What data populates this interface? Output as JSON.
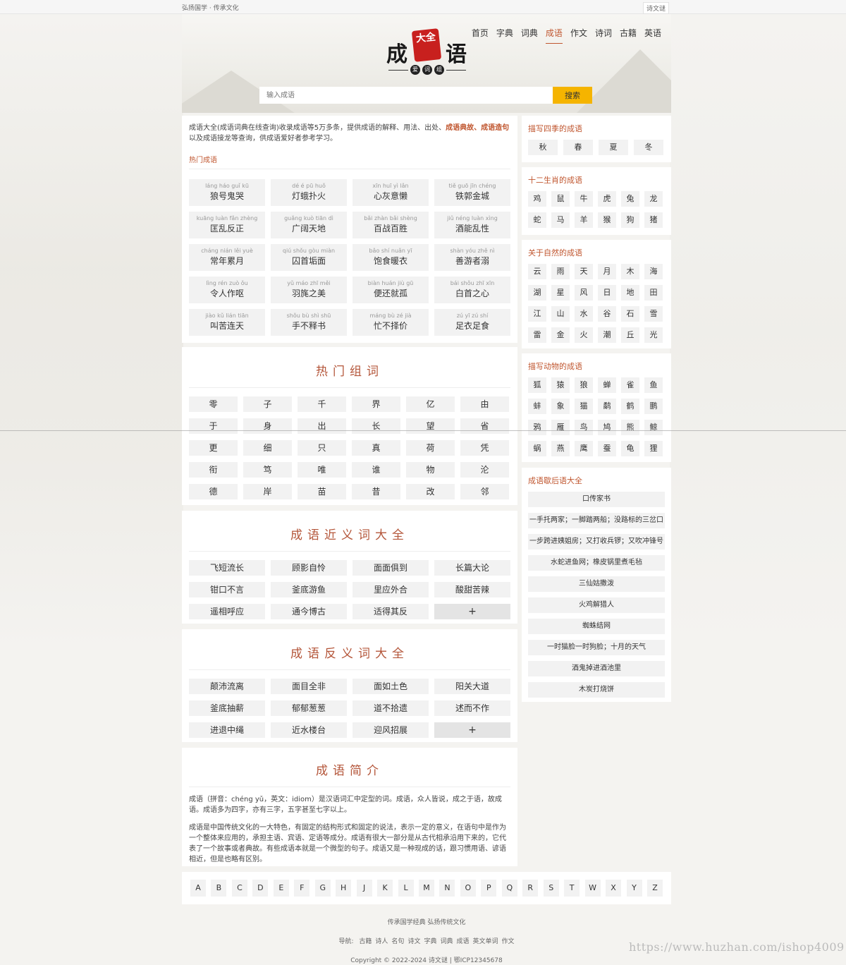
{
  "topbar": {
    "left": "弘扬国学 · 传承文化",
    "right": "诗文谜"
  },
  "nav": [
    "首页",
    "字典",
    "词典",
    "成语",
    "作文",
    "诗词",
    "古籍",
    "英语"
  ],
  "nav_active": 3,
  "logo": {
    "char1": "成",
    "seal": "大全",
    "char2": "语",
    "sub": [
      "爱",
      "词",
      "组"
    ]
  },
  "search": {
    "placeholder": "输入成语",
    "button": "搜索"
  },
  "intro": {
    "text1": "成语大全(成语词典在线查询)收录成语等5万多条，提供成语的解释、用法、出处、",
    "hl1": "成语典故",
    "sep": "、",
    "hl2": "成语造句",
    "text2": "以及成语接龙等查询，供成语爱好者参考学习。",
    "hot_title": "热门成语"
  },
  "hot_idioms": [
    {
      "py": "láng háo guǐ kū",
      "w": "狼号鬼哭"
    },
    {
      "py": "dé é pū huǒ",
      "w": "灯蛾扑火"
    },
    {
      "py": "xīn huī yì lǎn",
      "w": "心灰意懒"
    },
    {
      "py": "tiě guō jīn chéng",
      "w": "铁郭金城"
    },
    {
      "py": "kuāng luàn fǎn zhèng",
      "w": "匡乱反正"
    },
    {
      "py": "guǎng kuò tiān dì",
      "w": "广阔天地"
    },
    {
      "py": "bǎi zhàn bǎi shèng",
      "w": "百战百胜"
    },
    {
      "py": "jiǔ néng luàn xìng",
      "w": "酒能乱性"
    },
    {
      "py": "cháng nián lěi yuè",
      "w": "常年累月"
    },
    {
      "py": "qiú shǒu gòu miàn",
      "w": "囚首垢面"
    },
    {
      "py": "bǎo shí nuǎn yī",
      "w": "饱食暖衣"
    },
    {
      "py": "shàn yóu zhě nì",
      "w": "善游者溺"
    },
    {
      "py": "lìng rén zuò ǒu",
      "w": "令人作呕"
    },
    {
      "py": "yǔ máo zhī měi",
      "w": "羽旄之美"
    },
    {
      "py": "biàn huán jiù gū",
      "w": "便还就孤"
    },
    {
      "py": "bái shǒu zhī xīn",
      "w": "白首之心"
    },
    {
      "py": "jiào kǔ lián tiān",
      "w": "叫苦连天"
    },
    {
      "py": "shǒu bù shì shū",
      "w": "手不释书"
    },
    {
      "py": "máng bù zé jià",
      "w": "忙不择价"
    },
    {
      "py": "zú yī zú shí",
      "w": "足衣足食"
    }
  ],
  "hot_words": {
    "title": "热门组词",
    "items": [
      "零",
      "子",
      "千",
      "界",
      "亿",
      "由",
      "于",
      "身",
      "出",
      "长",
      "望",
      "省",
      "更",
      "细",
      "只",
      "真",
      "荷",
      "凭",
      "衔",
      "笃",
      "唯",
      "谁",
      "物",
      "沦",
      "德",
      "岸",
      "苗",
      "昔",
      "改",
      "邻"
    ]
  },
  "synonyms": {
    "title": "成语近义词大全",
    "items": [
      "飞短流长",
      "顾影自怜",
      "面面俱到",
      "长篇大论",
      "钳口不言",
      "釜底游鱼",
      "里应外合",
      "酸甜苦辣",
      "遥相呼应",
      "通今博古",
      "适得其反"
    ],
    "more": "+"
  },
  "antonyms": {
    "title": "成语反义词大全",
    "items": [
      "颠沛流离",
      "面目全非",
      "面如土色",
      "阳关大道",
      "釜底抽薪",
      "郁郁葱葱",
      "道不拾遗",
      "述而不作",
      "进退中绳",
      "近水楼台",
      "迎风招展"
    ],
    "more": "+"
  },
  "description": {
    "title": "成语简介",
    "p1": "成语（拼音：chéng yǔ，英文：idiom）是汉语词汇中定型的词。成语，众人皆说，成之于语，故成语。成语多为四字，亦有三字，五字甚至七字以上。",
    "p2": "成语是中国传统文化的一大特色，有固定的结构形式和固定的说法，表示一定的意义，在语句中是作为一个整体来应用的，承担主语、宾语、定语等成分。成语有很大一部分是从古代相承沿用下来的，它代表了一个故事或者典故。有些成语本就是一个微型的句子。成语又是一种现成的话，跟习惯用语、谚语相近，但是也略有区别。"
  },
  "side": {
    "seasons": {
      "title": "描写四季的成语",
      "items": [
        "秋",
        "春",
        "夏",
        "冬"
      ]
    },
    "zodiac": {
      "title": "十二生肖的成语",
      "items": [
        "鸡",
        "鼠",
        "牛",
        "虎",
        "兔",
        "龙",
        "蛇",
        "马",
        "羊",
        "猴",
        "狗",
        "猪"
      ]
    },
    "nature": {
      "title": "关于自然的成语",
      "items": [
        "云",
        "雨",
        "天",
        "月",
        "木",
        "海",
        "湖",
        "星",
        "风",
        "日",
        "地",
        "田",
        "江",
        "山",
        "水",
        "谷",
        "石",
        "雪",
        "雷",
        "金",
        "火",
        "潮",
        "丘",
        "光"
      ]
    },
    "animals": {
      "title": "描写动物的成语",
      "items": [
        "狐",
        "猿",
        "狼",
        "蝉",
        "雀",
        "鱼",
        "蚌",
        "象",
        "猫",
        "鹬",
        "鹤",
        "鹏",
        "鸦",
        "雁",
        "鸟",
        "鸠",
        "熊",
        "鲸",
        "蜗",
        "燕",
        "鹰",
        "蚕",
        "龟",
        "狸"
      ]
    },
    "xiehouyu": {
      "title": "成语歇后语大全",
      "items": [
        "口传家书",
        "一手托两家；一脚踏两船；没路标的三岔口",
        "一步跨进姨姐房；又打收兵锣；又吹冲锋号",
        "水蛇进鱼网；橡皮锅里煮毛毡",
        "三仙姑撒泼",
        "火鸡解猎人",
        "蜘蛛结网",
        "一时猫脸一时狗脸；十月的天气",
        "酒鬼掉进酒池里",
        "木炭打烧饼"
      ]
    }
  },
  "alphabet": [
    "A",
    "B",
    "C",
    "D",
    "E",
    "F",
    "G",
    "H",
    "J",
    "K",
    "L",
    "M",
    "N",
    "O",
    "P",
    "Q",
    "R",
    "S",
    "T",
    "W",
    "X",
    "Y",
    "Z"
  ],
  "footer": {
    "line1": "传承国学经典 弘扬传统文化",
    "nav_label": "导航:",
    "nav": [
      "古籍",
      "诗人",
      "名句",
      "诗文",
      "字典",
      "词典",
      "成语",
      "英文单词",
      "作文"
    ],
    "copyright": "Copyright © 2022-2024 诗文谜 | 鄂ICP12345678"
  },
  "watermark": "https://www.huzhan.com/ishop4009"
}
